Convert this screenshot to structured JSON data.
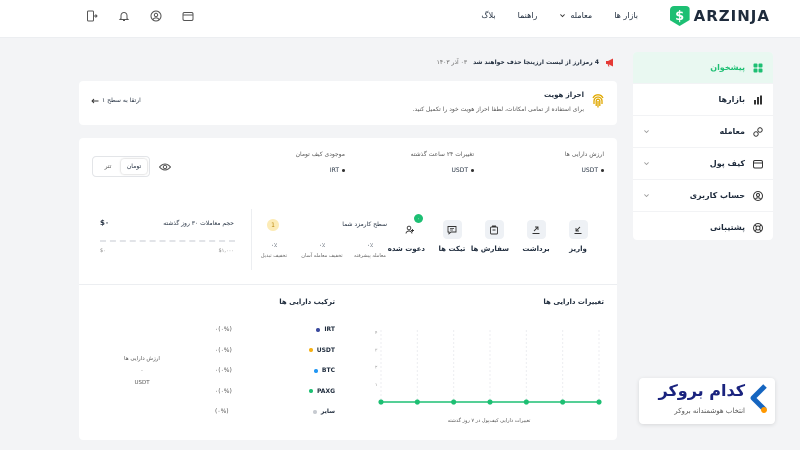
{
  "brand": {
    "name": "ARZINJA",
    "mark": "$"
  },
  "topnav": [
    {
      "label": "بازار ها"
    },
    {
      "label": "معامله"
    },
    {
      "label": "راهنما"
    },
    {
      "label": "بلاگ"
    }
  ],
  "sidebar": {
    "items": [
      {
        "label": "پیشخوان",
        "icon": "dashboard-icon",
        "active": true
      },
      {
        "label": "بازارها",
        "icon": "chart-bars-icon"
      },
      {
        "label": "معامله",
        "icon": "exchange-icon"
      },
      {
        "label": "کیف پول",
        "icon": "wallet-icon"
      },
      {
        "label": "حساب کاربری",
        "icon": "user-icon"
      },
      {
        "label": "پشتیبانی",
        "icon": "support-icon"
      }
    ]
  },
  "announcement": {
    "text": "4 رمزارز از لیست ارزینجا حذف خواهند شد",
    "date": "۰۳ آذر ۱۴۰۳"
  },
  "identity": {
    "title": "احراز هویت",
    "desc": "برای استفاده از تمامی امکانات، لطفا احراز هویت خود را تکمیل کنید.",
    "link": "ارتقا به سطح ۱"
  },
  "stats": [
    {
      "label": "ارزش دارایی ها",
      "value": "USDT"
    },
    {
      "label": "تغییرات ۲۴ ساعت گذشته",
      "value": "USDT"
    },
    {
      "label": "موجودی کیف تومان",
      "value": "IRT"
    }
  ],
  "currency_toggle": {
    "option_active": "تومان",
    "option_other": "تتر"
  },
  "actions": [
    {
      "label": "واریز"
    },
    {
      "label": "برداشت"
    },
    {
      "label": "سفارش ها"
    },
    {
      "label": "تیکت ها"
    },
    {
      "label": "دعوت شده",
      "badge": "۰"
    }
  ],
  "tier": {
    "title": "سطح کارمزد شما",
    "level": "1",
    "cols": [
      {
        "value": "۰٪",
        "label": "معامله پیشرفته"
      },
      {
        "value": "۰٪",
        "label": "تخفیف معامله آسان"
      },
      {
        "value": "۰٪",
        "label": "تخفیف تبدیل"
      }
    ]
  },
  "volume": {
    "title": "حجم معاملات ۳۰ روز گذشته",
    "value": "$۰",
    "min": "$۰",
    "max": "$۱,۰۰۰"
  },
  "changes_section": {
    "title": "تغییرات دارایی ها",
    "caption": "تغییرات دارایی کیف‌پول در ۷ روز گذشته"
  },
  "chart_data": {
    "type": "line",
    "x": [
      1,
      2,
      3,
      4,
      5,
      6,
      7
    ],
    "values": [
      0,
      0,
      0,
      0,
      0,
      0,
      0
    ],
    "yticks": [
      "۴",
      "۳",
      "۲",
      "۱"
    ],
    "color": "#1dbf73"
  },
  "composition": {
    "title": "ترکیب دارایی ها",
    "ring_label": "ارزش دارایی ها",
    "ring_value": "۰",
    "ring_unit": "USDT",
    "items": [
      {
        "name": "IRT",
        "pct": "(۰%)۰",
        "color": "#3b4a9e"
      },
      {
        "name": "USDT",
        "pct": "(۰%)۰",
        "color": "#f5b014"
      },
      {
        "name": "BTC",
        "pct": "(۰%)۰",
        "color": "#2196f3"
      },
      {
        "name": "PAXG",
        "pct": "(۰%)۰",
        "color": "#1dbf73"
      },
      {
        "name": "سایر",
        "pct": "(۰%)",
        "color": "#c7cbd1"
      }
    ]
  },
  "watermark": {
    "title": "کدام بروکر",
    "subtitle": "انتخاب هوشمندانه بروکر"
  }
}
